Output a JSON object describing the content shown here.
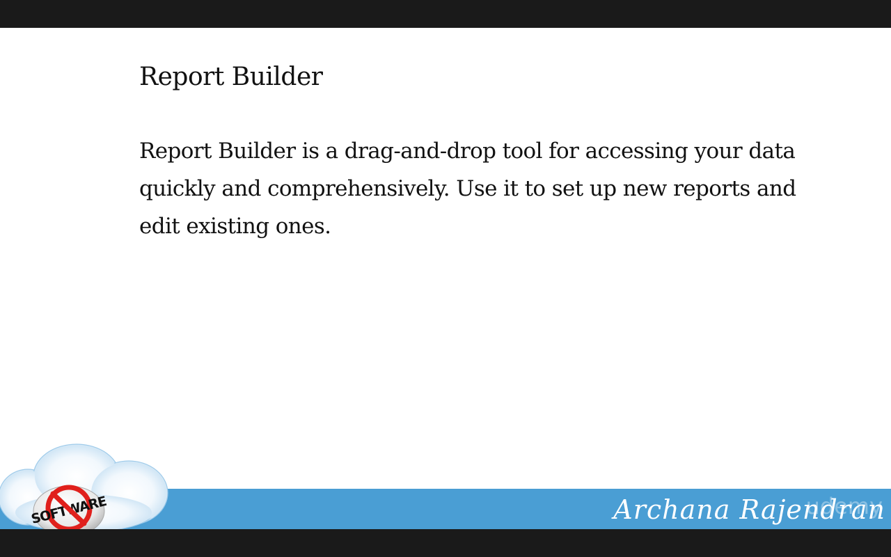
{
  "slide": {
    "title": "Report Builder",
    "body": "Report Builder is a drag-and-drop tool for accessing your data quickly and comprehensively. Use it to set up new reports and edit existing ones."
  },
  "footer": {
    "logo_text": "SOFTWARE",
    "author": "Archana Rajendran",
    "watermark": "udemy",
    "band_color": "#4a9ed4"
  }
}
